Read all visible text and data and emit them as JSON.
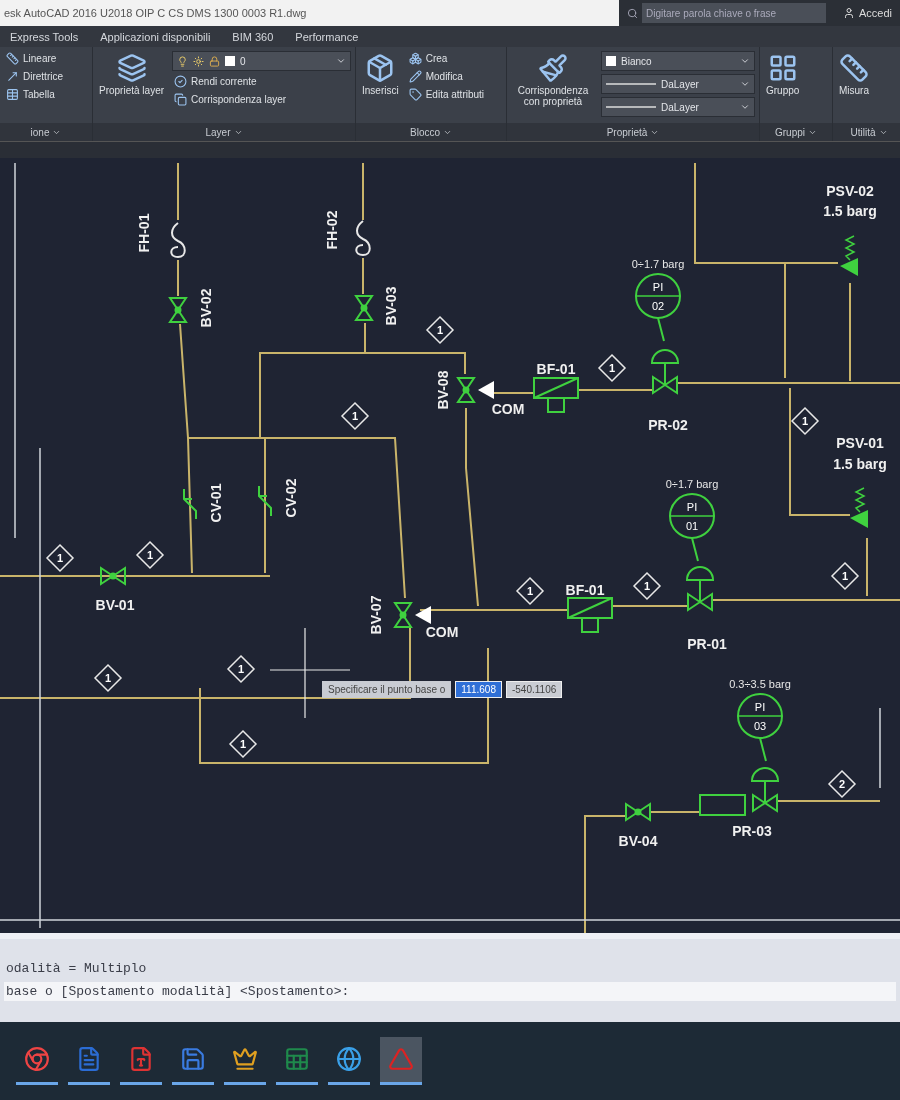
{
  "title_bar": {
    "title": "esk AutoCAD 2016   U2018 OIP C CS DMS 1300 0003 R1.dwg",
    "search_placeholder": "Digitare parola chiave o frase",
    "sign_in": "Accedi"
  },
  "ribbon_tabs": [
    {
      "label": "Express Tools",
      "selected": false
    },
    {
      "label": "Applicazioni disponibili",
      "selected": false
    },
    {
      "label": "BIM 360",
      "selected": false
    },
    {
      "label": "Performance",
      "selected": false
    }
  ],
  "panels": [
    {
      "title": "ione",
      "columns": [
        [
          {
            "kind": "small",
            "label": "Lineare"
          },
          {
            "kind": "small",
            "label": "Direttrice"
          },
          {
            "kind": "small",
            "label": "Tabella"
          }
        ]
      ]
    },
    {
      "title": "Layer",
      "columns": [
        [
          {
            "kind": "large",
            "label": "Proprietà layer"
          }
        ],
        [
          {
            "kind": "layer_dropdown",
            "label": "0"
          },
          {
            "kind": "small",
            "label": "Rendi corrente"
          },
          {
            "kind": "small",
            "label": "Corrispondenza layer"
          }
        ]
      ]
    },
    {
      "title": "Blocco",
      "columns": [
        [
          {
            "kind": "large",
            "label": "Inserisci"
          }
        ],
        [
          {
            "kind": "small",
            "label": "Crea"
          },
          {
            "kind": "small",
            "label": "Modifica"
          },
          {
            "kind": "small",
            "label": "Edita attributi"
          }
        ]
      ]
    },
    {
      "title": "Proprietà",
      "columns": [
        [
          {
            "kind": "large",
            "label": "Corrispondenza con proprietà"
          }
        ],
        [
          {
            "kind": "color_dropdown",
            "label": "Bianco"
          },
          {
            "kind": "linetype_dropdown",
            "label": "DaLayer"
          },
          {
            "kind": "linetype_dropdown",
            "label": "DaLayer"
          }
        ]
      ]
    },
    {
      "title": "Gruppi",
      "columns": [
        [
          {
            "kind": "large",
            "label": "Gruppo"
          }
        ]
      ]
    },
    {
      "title": "Utilità",
      "columns": [
        [
          {
            "kind": "large",
            "label": "Misura"
          }
        ]
      ]
    }
  ],
  "diagram": {
    "tags": [
      {
        "text": "FH-01"
      },
      {
        "text": "FH-02"
      },
      {
        "text": "BV-02"
      },
      {
        "text": "BV-03"
      },
      {
        "text": "BV-08"
      },
      {
        "text": "COM"
      },
      {
        "text": "BF-01"
      },
      {
        "text": "PR-02"
      },
      {
        "text": "PSV-02"
      },
      {
        "text": "1.5 barg"
      },
      {
        "text": "PSV-01"
      },
      {
        "text": "1.5 barg"
      },
      {
        "text": "CV-01"
      },
      {
        "text": "CV-02"
      },
      {
        "text": "BV-01"
      },
      {
        "text": "BV-07"
      },
      {
        "text": "COM"
      },
      {
        "text": "BF-01"
      },
      {
        "text": "PR-01"
      },
      {
        "text": "BV-04"
      },
      {
        "text": "PR-03"
      }
    ],
    "instruments": [
      {
        "type": "PI",
        "number": "02",
        "range": "0÷1.7 barg"
      },
      {
        "type": "PI",
        "number": "01",
        "range": "0÷1.7 barg"
      },
      {
        "type": "PI",
        "number": "03",
        "range": "0.3÷3.5 barg"
      }
    ],
    "markers": [
      {
        "text": "1"
      },
      {
        "text": "1"
      },
      {
        "text": "1"
      },
      {
        "text": "1"
      },
      {
        "text": "1"
      },
      {
        "text": "1"
      },
      {
        "text": "1"
      },
      {
        "text": "1"
      },
      {
        "text": "1"
      },
      {
        "text": "1"
      },
      {
        "text": "1"
      },
      {
        "text": "1"
      },
      {
        "text": "2"
      }
    ]
  },
  "dynamic_input": {
    "prompt": "Specificare il punto base o",
    "fields": [
      {
        "value": "111.608",
        "selected": true
      },
      {
        "value": "-540.1106",
        "selected": false
      }
    ]
  },
  "command_line": {
    "history": "odalità = Multiplo",
    "prompt": "base o [Spostamento modalità] <Spostamento>:"
  },
  "taskbar": {
    "apps": [
      {
        "selected": false
      },
      {
        "selected": false
      },
      {
        "selected": false
      },
      {
        "selected": false
      },
      {
        "selected": false
      },
      {
        "selected": false
      },
      {
        "selected": false
      },
      {
        "selected": true
      }
    ]
  }
}
